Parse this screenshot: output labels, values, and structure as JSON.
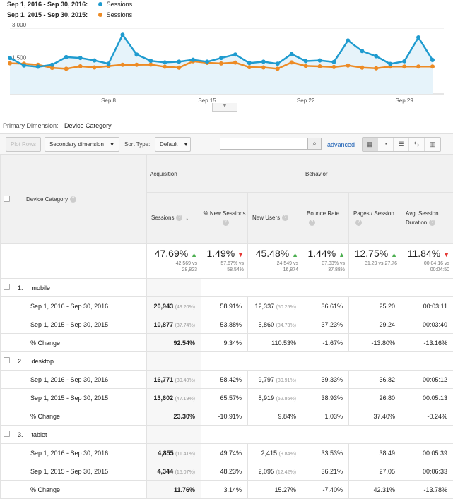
{
  "legend": [
    {
      "range": "Sep 1, 2016 - Sep 30, 2016:",
      "series": "Sessions",
      "color": "#1f9bcf"
    },
    {
      "range": "Sep 1, 2015 - Sep 30, 2015:",
      "series": "Sessions",
      "color": "#ed8b25"
    }
  ],
  "chart_data": {
    "type": "line",
    "y_ticks": [
      "3,000",
      "1,500"
    ],
    "ylim": [
      0,
      3000
    ],
    "x_ticks": [
      "...",
      "Sep 8",
      "Sep 15",
      "Sep 22",
      "Sep 29"
    ],
    "x_tick_days": [
      1,
      8,
      15,
      22,
      29
    ],
    "days": [
      1,
      2,
      3,
      4,
      5,
      6,
      7,
      8,
      9,
      10,
      11,
      12,
      13,
      14,
      15,
      16,
      17,
      18,
      19,
      20,
      21,
      22,
      23,
      24,
      25,
      26,
      27,
      28,
      29,
      30
    ],
    "series": [
      {
        "values": [
          1640,
          1300,
          1240,
          1330,
          1680,
          1640,
          1530,
          1380,
          2700,
          1800,
          1510,
          1440,
          1470,
          1560,
          1470,
          1640,
          1800,
          1410,
          1470,
          1380,
          1820,
          1500,
          1530,
          1460,
          2440,
          1960,
          1720,
          1370,
          1490,
          2580,
          1550
        ],
        "color": "#1f9bcf"
      },
      {
        "values": [
          1400,
          1380,
          1330,
          1190,
          1150,
          1260,
          1210,
          1270,
          1330,
          1330,
          1340,
          1240,
          1200,
          1490,
          1420,
          1390,
          1430,
          1220,
          1210,
          1150,
          1440,
          1280,
          1260,
          1230,
          1300,
          1200,
          1170,
          1250,
          1250,
          1250,
          1250
        ],
        "color": "#ed8b25"
      }
    ]
  },
  "primary_dimension": {
    "label": "Primary Dimension:",
    "value": "Device Category"
  },
  "toolbar": {
    "plot_rows": "Plot Rows",
    "secondary_dimension": "Secondary dimension",
    "sort_type_label": "Sort Type:",
    "sort_type_value": "Default",
    "search_placeholder": "",
    "advanced": "advanced"
  },
  "table": {
    "dimension_header": "Device Category",
    "group_acquisition": "Acquisition",
    "group_behavior": "Behavior",
    "columns": [
      "Sessions",
      "% New Sessions",
      "New Users",
      "Bounce Rate",
      "Pages / Session",
      "Avg. Session Duration"
    ],
    "totals": [
      {
        "big": "47.69%",
        "dir": "up",
        "sub1": "42,569 vs",
        "sub2": "28,823"
      },
      {
        "big": "1.49%",
        "dir": "down",
        "sub1": "57.67% vs",
        "sub2": "58.54%"
      },
      {
        "big": "45.48%",
        "dir": "up",
        "sub1": "24,549 vs",
        "sub2": "16,874"
      },
      {
        "big": "1.44%",
        "dir": "up",
        "sub1": "37.33% vs",
        "sub2": "37.88%"
      },
      {
        "big": "12.75%",
        "dir": "up",
        "sub1": "31.29 vs 27.76",
        "sub2": ""
      },
      {
        "big": "11.84%",
        "dir": "down",
        "sub1": "00:04:16 vs",
        "sub2": "00:04:50"
      }
    ],
    "devices": [
      {
        "index": "1.",
        "name": "mobile",
        "rows": [
          {
            "label": "Sep 1, 2016 - Sep 30, 2016",
            "sessions": "20,943",
            "sessions_pct": "(49.20%)",
            "new_sessions": "58.91%",
            "new_users": "12,337",
            "new_users_pct": "(50.25%)",
            "bounce": "36.61%",
            "pages": "25.20",
            "duration": "00:03:11"
          },
          {
            "label": "Sep 1, 2015 - Sep 30, 2015",
            "sessions": "10,877",
            "sessions_pct": "(37.74%)",
            "new_sessions": "53.88%",
            "new_users": "5,860",
            "new_users_pct": "(34.73%)",
            "bounce": "37.23%",
            "pages": "29.24",
            "duration": "00:03:40"
          },
          {
            "label": "% Change",
            "sessions": "92.54%",
            "sessions_pct": "",
            "new_sessions": "9.34%",
            "new_users": "110.53%",
            "new_users_pct": "",
            "bounce": "-1.67%",
            "pages": "-13.80%",
            "duration": "-13.16%"
          }
        ]
      },
      {
        "index": "2.",
        "name": "desktop",
        "rows": [
          {
            "label": "Sep 1, 2016 - Sep 30, 2016",
            "sessions": "16,771",
            "sessions_pct": "(39.40%)",
            "new_sessions": "58.42%",
            "new_users": "9,797",
            "new_users_pct": "(39.91%)",
            "bounce": "39.33%",
            "pages": "36.82",
            "duration": "00:05:12"
          },
          {
            "label": "Sep 1, 2015 - Sep 30, 2015",
            "sessions": "13,602",
            "sessions_pct": "(47.19%)",
            "new_sessions": "65.57%",
            "new_users": "8,919",
            "new_users_pct": "(52.86%)",
            "bounce": "38.93%",
            "pages": "26.80",
            "duration": "00:05:13"
          },
          {
            "label": "% Change",
            "sessions": "23.30%",
            "sessions_pct": "",
            "new_sessions": "-10.91%",
            "new_users": "9.84%",
            "new_users_pct": "",
            "bounce": "1.03%",
            "pages": "37.40%",
            "duration": "-0.24%"
          }
        ]
      },
      {
        "index": "3.",
        "name": "tablet",
        "rows": [
          {
            "label": "Sep 1, 2016 - Sep 30, 2016",
            "sessions": "4,855",
            "sessions_pct": "(11.41%)",
            "new_sessions": "49.74%",
            "new_users": "2,415",
            "new_users_pct": "(9.84%)",
            "bounce": "33.53%",
            "pages": "38.49",
            "duration": "00:05:39"
          },
          {
            "label": "Sep 1, 2015 - Sep 30, 2015",
            "sessions": "4,344",
            "sessions_pct": "(15.07%)",
            "new_sessions": "48.23%",
            "new_users": "2,095",
            "new_users_pct": "(12.42%)",
            "bounce": "36.21%",
            "pages": "27.05",
            "duration": "00:06:33"
          },
          {
            "label": "% Change",
            "sessions": "11.76%",
            "sessions_pct": "",
            "new_sessions": "3.14%",
            "new_users": "15.27%",
            "new_users_pct": "",
            "bounce": "-7.40%",
            "pages": "42.31%",
            "duration": "-13.78%"
          }
        ]
      }
    ]
  }
}
